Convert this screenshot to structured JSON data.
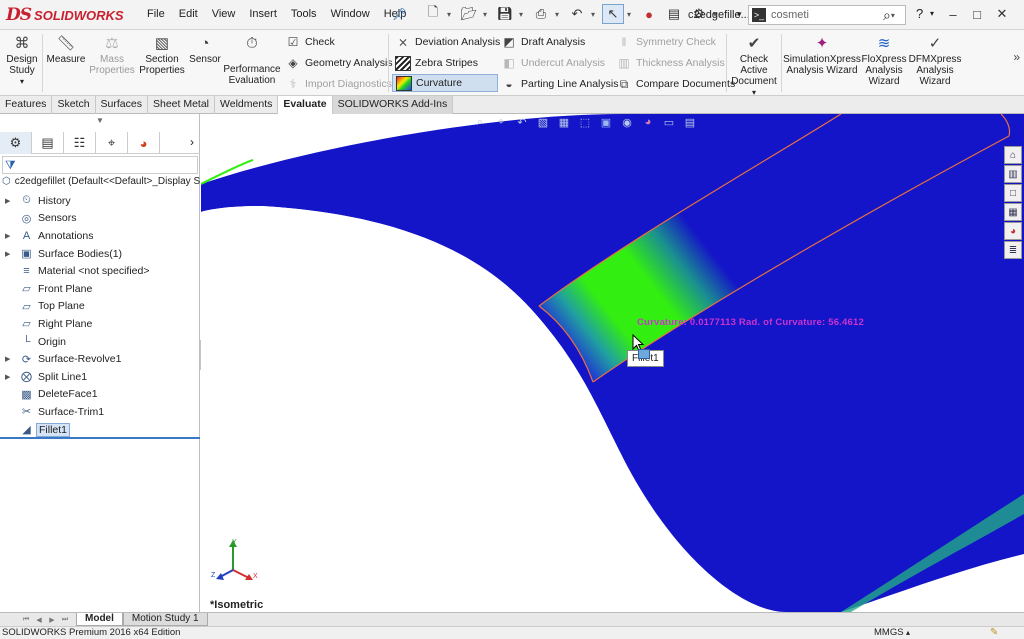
{
  "app": {
    "logo_mark": "DS",
    "logo_text": "SOLIDWORKS",
    "document_name": "c2edgefille...",
    "status_text": "SOLIDWORKS Premium 2016 x64 Edition",
    "units": "MMGS"
  },
  "menu": [
    "File",
    "Edit",
    "View",
    "Insert",
    "Tools",
    "Window",
    "Help"
  ],
  "search": {
    "value": "cosmeti"
  },
  "help_label": "?",
  "command_manager": {
    "design_study": "Design Study",
    "measure": "Measure",
    "mass_properties": "Mass Properties",
    "section_properties": "Section Properties",
    "sensor": "Sensor",
    "performance_evaluation": "Performance Evaluation",
    "check": "Check",
    "geometry_analysis": "Geometry Analysis",
    "import_diagnostics": "Import Diagnostics",
    "deviation_analysis": "Deviation Analysis",
    "zebra_stripes": "Zebra Stripes",
    "curvature": "Curvature",
    "draft_analysis": "Draft Analysis",
    "undercut_analysis": "Undercut Analysis",
    "parting_line_analysis": "Parting Line Analysis",
    "symmetry_check": "Symmetry Check",
    "thickness_analysis": "Thickness Analysis",
    "compare_documents": "Compare Documents",
    "check_active_document": "Check Active Document",
    "simulationxpress": "SimulationXpress Analysis Wizard",
    "floxpress": "FloXpress Analysis Wizard",
    "dfmxpress": "DFMXpress Analysis Wizard"
  },
  "tabs": [
    "Features",
    "Sketch",
    "Surfaces",
    "Sheet Metal",
    "Weldments",
    "Evaluate",
    "SOLIDWORKS Add-Ins"
  ],
  "active_tab": "Evaluate",
  "feature_tree": {
    "root": "c2edgefillet  (Default<<Default>_Display S",
    "items": [
      {
        "label": "History",
        "icon": "history-icon",
        "expandable": true
      },
      {
        "label": "Sensors",
        "icon": "sensors-icon",
        "expandable": false
      },
      {
        "label": "Annotations",
        "icon": "annotations-icon",
        "expandable": true
      },
      {
        "label": "Surface Bodies(1)",
        "icon": "surface-bodies-icon",
        "expandable": true
      },
      {
        "label": "Material <not specified>",
        "icon": "material-icon",
        "expandable": false
      },
      {
        "label": "Front Plane",
        "icon": "plane-icon",
        "expandable": false
      },
      {
        "label": "Top Plane",
        "icon": "plane-icon",
        "expandable": false
      },
      {
        "label": "Right Plane",
        "icon": "plane-icon",
        "expandable": false
      },
      {
        "label": "Origin",
        "icon": "origin-icon",
        "expandable": false
      },
      {
        "label": "Surface-Revolve1",
        "icon": "surface-revolve-icon",
        "expandable": true
      },
      {
        "label": "Split Line1",
        "icon": "split-line-icon",
        "expandable": true
      },
      {
        "label": "DeleteFace1",
        "icon": "delete-face-icon",
        "expandable": false
      },
      {
        "label": "Surface-Trim1",
        "icon": "surface-trim-icon",
        "expandable": false
      },
      {
        "label": "Fillet1",
        "icon": "fillet-icon",
        "expandable": false,
        "selected": true
      }
    ]
  },
  "graphics": {
    "curvature_readout": "Curvature: 0.0177113  Rad. of Curvature: 56.4612",
    "tooltip": "Fillet1",
    "view_name": "*Isometric",
    "triad_labels": {
      "x": "X",
      "y": "Y",
      "z": "Z"
    }
  },
  "bottom_tabs": [
    "Model",
    "Motion Study 1"
  ],
  "colors": {
    "surface_blue": "#1414c8",
    "curvature_green": "#2cf000",
    "edge_orange": "#e87040",
    "readout_magenta": "#cc33cc",
    "selection_blue": "#3a78c8",
    "brand_red": "#c8202f"
  }
}
